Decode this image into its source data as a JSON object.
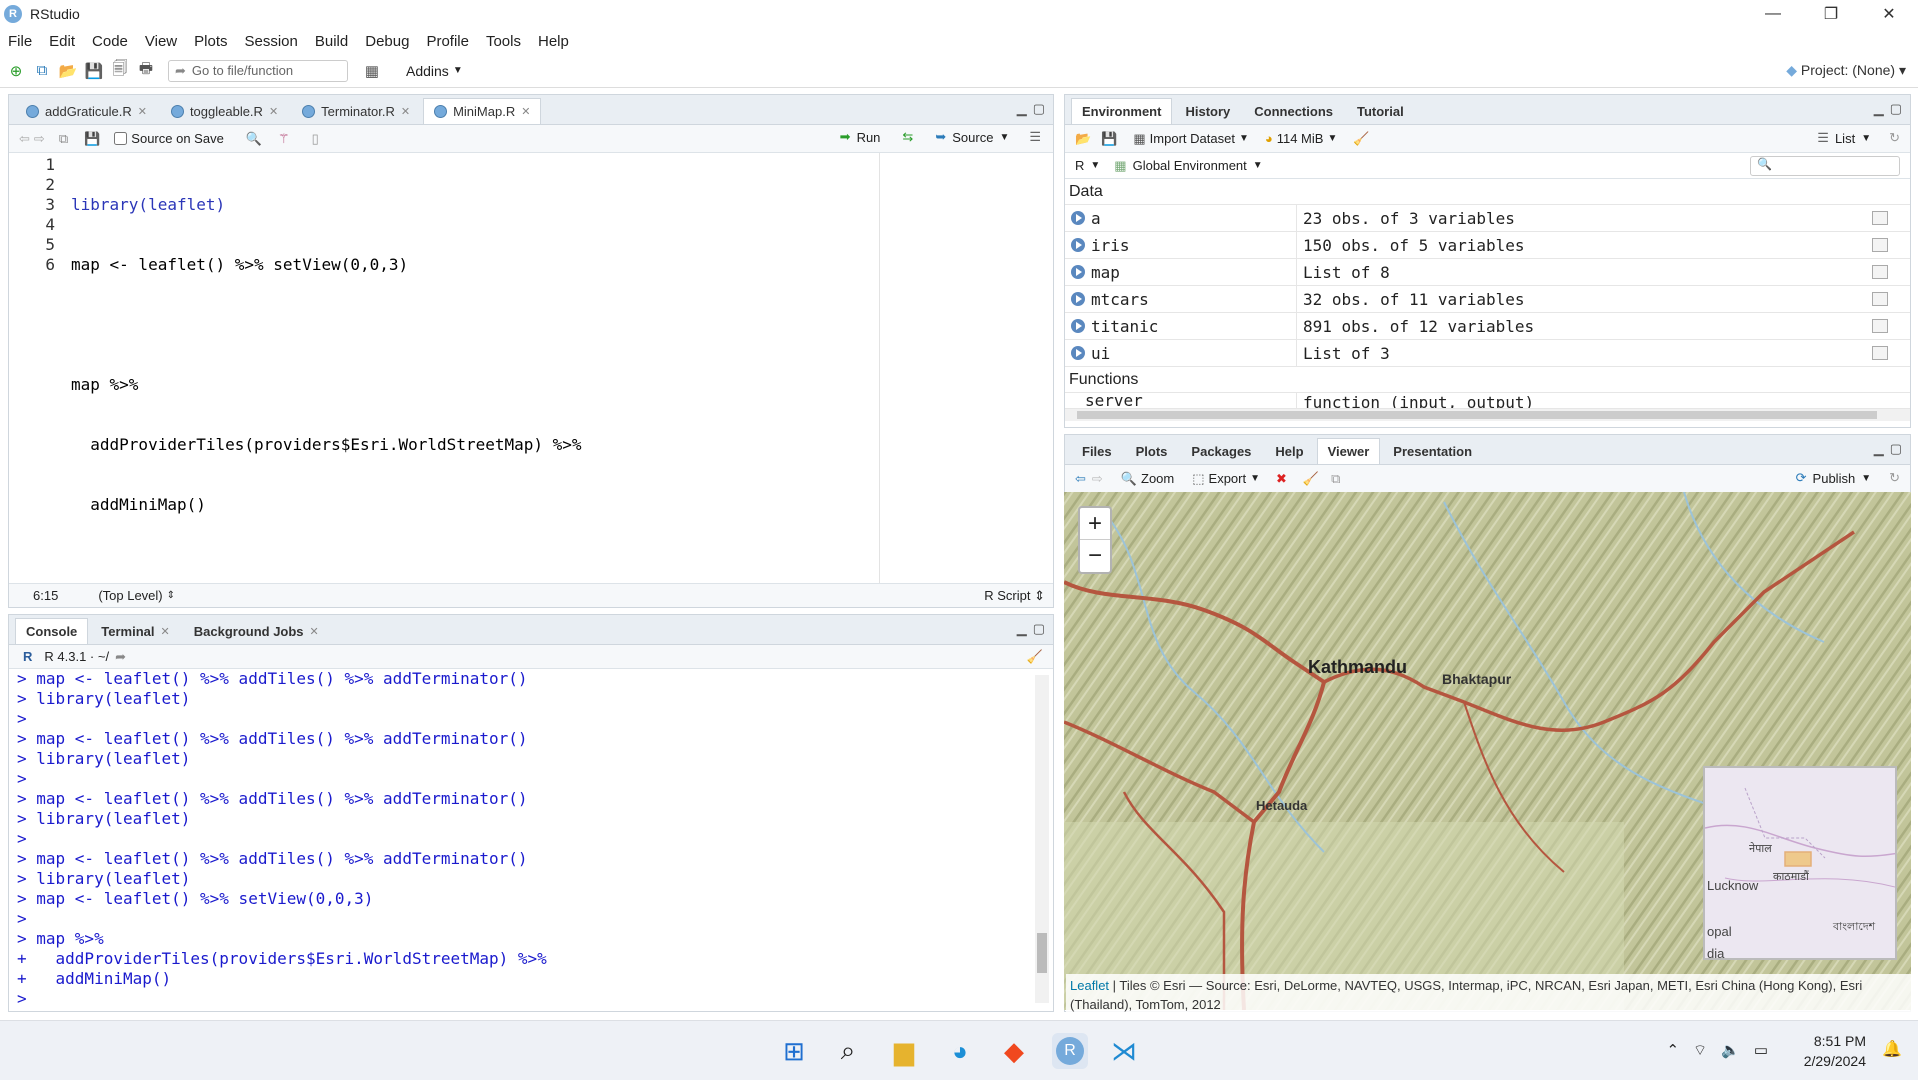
{
  "window": {
    "title": "RStudio",
    "logo": "R"
  },
  "menu": [
    "File",
    "Edit",
    "Code",
    "View",
    "Plots",
    "Session",
    "Build",
    "Debug",
    "Profile",
    "Tools",
    "Help"
  ],
  "toolbar": {
    "goto_placeholder": "Go to file/function",
    "addins": "Addins",
    "project": "Project: (None)"
  },
  "editor": {
    "tabs": [
      {
        "label": "addGraticule.R"
      },
      {
        "label": "toggleable.R"
      },
      {
        "label": "Terminator.R"
      },
      {
        "label": "MiniMap.R"
      }
    ],
    "source_on_save": "Source on Save",
    "run": "Run",
    "source": "Source",
    "line_numbers": [
      "1",
      "2",
      "3",
      "4",
      "5",
      "6"
    ],
    "lines": [
      "library(leaflet)",
      "map <- leaflet() %>% setView(0,0,3)",
      "",
      "map %>%",
      "  addProviderTiles(providers$Esri.WorldStreetMap) %>%",
      "  addMiniMap()"
    ],
    "status": {
      "position": "6:15",
      "scope": "(Top Level)",
      "filetype": "R Script"
    }
  },
  "console": {
    "tabs": [
      "Console",
      "Terminal",
      "Background Jobs"
    ],
    "version": "R 4.3.1 · ~/",
    "lines": [
      "> map <- leaflet() %>% addTiles() %>% addTerminator()",
      "> library(leaflet)",
      ">",
      "> map <- leaflet() %>% addTiles() %>% addTerminator()",
      "> library(leaflet)",
      ">",
      "> map <- leaflet() %>% addTiles() %>% addTerminator()",
      "> library(leaflet)",
      ">",
      "> map <- leaflet() %>% addTiles() %>% addTerminator()",
      "> library(leaflet)",
      "> map <- leaflet() %>% setView(0,0,3)",
      ">",
      "> map %>%",
      "+   addProviderTiles(providers$Esri.WorldStreetMap) %>%",
      "+   addMiniMap()",
      "> "
    ]
  },
  "environment": {
    "tabs": [
      "Environment",
      "History",
      "Connections",
      "Tutorial"
    ],
    "import_dataset": "Import Dataset",
    "memory": "114 MiB",
    "view_mode": "List",
    "lang": "R",
    "scope": "Global Environment",
    "section_data": "Data",
    "rows": [
      {
        "name": "a",
        "value": "23 obs. of 3 variables",
        "icon": "grid-icon"
      },
      {
        "name": "iris",
        "value": "150 obs. of 5 variables",
        "icon": "grid-icon"
      },
      {
        "name": "map",
        "value": "List of  8",
        "icon": "search-icon"
      },
      {
        "name": "mtcars",
        "value": "32 obs. of 11 variables",
        "icon": "grid-icon"
      },
      {
        "name": "titanic",
        "value": "891 obs. of 12 variables",
        "icon": "grid-icon"
      },
      {
        "name": "ui",
        "value": "List of  3",
        "icon": "search-icon"
      }
    ],
    "section_functions": "Functions",
    "fn_rows": [
      {
        "name": "server",
        "value": "function (input, output)"
      }
    ]
  },
  "viewer": {
    "tabs": [
      "Files",
      "Plots",
      "Packages",
      "Help",
      "Viewer",
      "Presentation"
    ],
    "zoom": "Zoom",
    "export": "Export",
    "publish": "Publish",
    "map_labels": {
      "kathmandu": "Kathmandu",
      "bhaktapur": "Bhaktapur",
      "hetauda": "Hetauda"
    },
    "minimap_labels": {
      "nepal": "नेपाल",
      "kathmandu": "काठमाडौं",
      "lucknow": "Lucknow",
      "opal": "opal",
      "bangladesh": "বাংলাদেশ",
      "dia": "dia"
    },
    "attribution_link": "Leaflet",
    "attribution": " | Tiles © Esri — Source: Esri, DeLorme, NAVTEQ, USGS, Intermap, iPC, NRCAN, Esri Japan, METI, Esri China (Hong Kong), Esri (Thailand), TomTom, 2012"
  },
  "taskbar": {
    "time": "8:51 PM",
    "date": "2/29/2024"
  },
  "colors": {
    "accent": "#75aadb",
    "console_text": "#1a1acd",
    "road": "#b5563f"
  }
}
